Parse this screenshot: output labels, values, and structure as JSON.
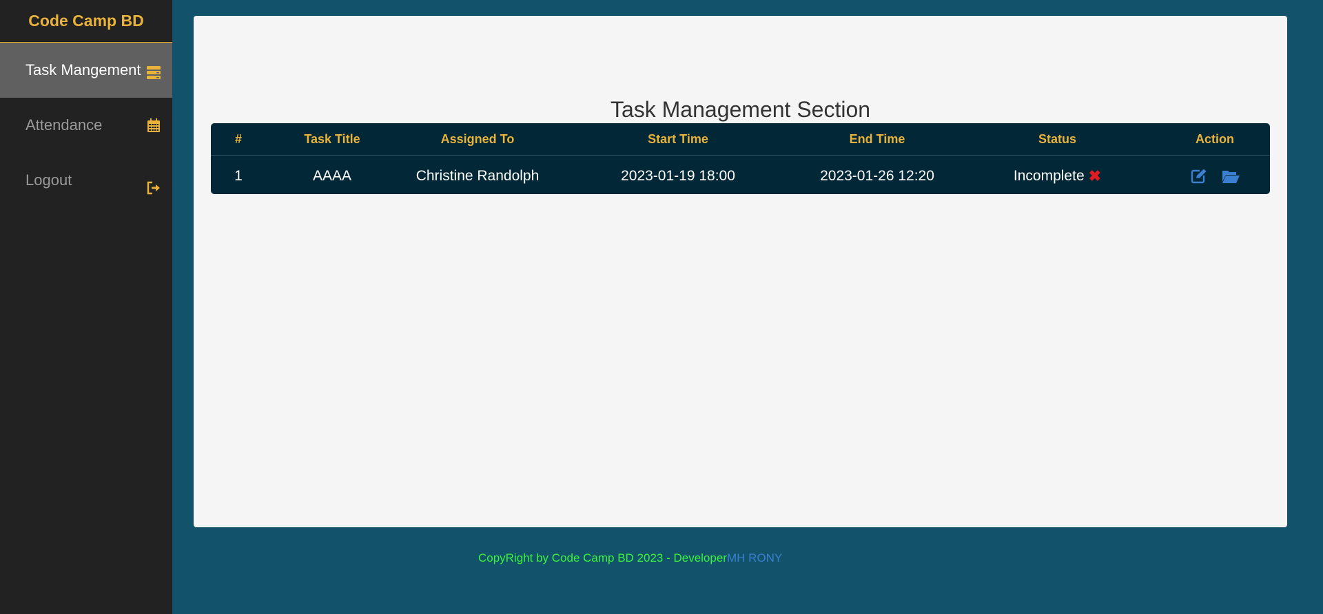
{
  "brand": "Code Camp BD",
  "sidebar": {
    "items": [
      {
        "label": "Task Mangement",
        "icon": "tasks-icon",
        "active": true
      },
      {
        "label": "Attendance",
        "icon": "calendar-icon",
        "active": false
      },
      {
        "label": "Logout",
        "icon": "logout-icon",
        "active": false
      }
    ]
  },
  "main": {
    "title": "Task Management Section",
    "table": {
      "headers": [
        "#",
        "Task Title",
        "Assigned To",
        "Start Time",
        "End Time",
        "Status",
        "Action"
      ],
      "rows": [
        {
          "num": "1",
          "title": "AAAA",
          "assigned": "Christine Randolph",
          "start": "2023-01-19 18:00",
          "end": "2023-01-26 12:20",
          "status": "Incomplete",
          "status_icon": "x-mark-icon",
          "actions": [
            "edit-icon",
            "folder-open-icon"
          ]
        }
      ]
    }
  },
  "footer": {
    "text": "CopyRight by Code Camp BD 2023 - Developer",
    "developer": "MH RONY"
  },
  "colors": {
    "accent": "#e8b23b",
    "background": "#12536b",
    "sidebar": "#222222",
    "table": "#022838",
    "status_incomplete": "#e11b22",
    "action_icons": "#3a7fd0",
    "footer_text": "#3cf23c"
  }
}
